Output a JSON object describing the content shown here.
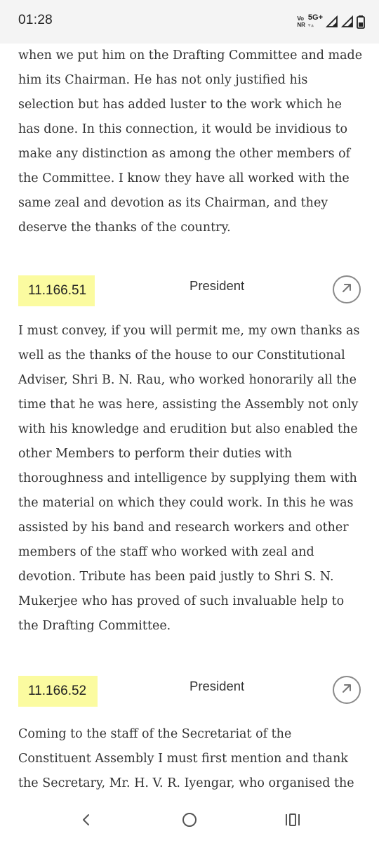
{
  "status_bar": {
    "time": "01:28",
    "volte_top": "Vo",
    "volte_bottom": "NR",
    "network": "5G+"
  },
  "content": {
    "paragraphs": [
      "when we put him on the Drafting Committee and made him its Chairman. He has not only justified his selection but has added luster to the work which he has done. In this connection, it would be invidious to make any distinction as among the other members of the Committee. I know they have all worked with the same zeal and devotion as its Chairman, and they deserve the thanks of the country.",
      "I must convey, if you will permit me, my own thanks as well as the thanks of the house to our Constitutional Adviser, Shri B. N. Rau, who worked honorarily all the time that he was here, assisting the Assembly not only with his knowledge and erudition but also enabled the other Members to perform their duties with thoroughness and intelligence by supplying them with the material on which they could work. In this he was assisted by his band and research workers and other members of the staff who worked with zeal and devotion. Tribute has been paid justly to Shri S. N. Mukerjee who has proved of such invaluable help to the Drafting Committee.",
      "Coming to the staff of the Secretariat of the Constituent Assembly I must first mention and thank the Secretary, Mr. H. V. R. Iyengar, who organised the Secretariat as an"
    ],
    "entries": [
      {
        "id": "11.166.51",
        "speaker": "President",
        "link_icon": "arrow-up-right-icon"
      },
      {
        "id": "11.166.52",
        "speaker": "President",
        "link_icon": "arrow-up-right-icon"
      }
    ],
    "highlight_color": "#fbfba0"
  },
  "nav_bar": {
    "back_icon": "chevron-left-icon",
    "home_icon": "circle-home-icon",
    "recents_icon": "recents-bars-icon"
  }
}
